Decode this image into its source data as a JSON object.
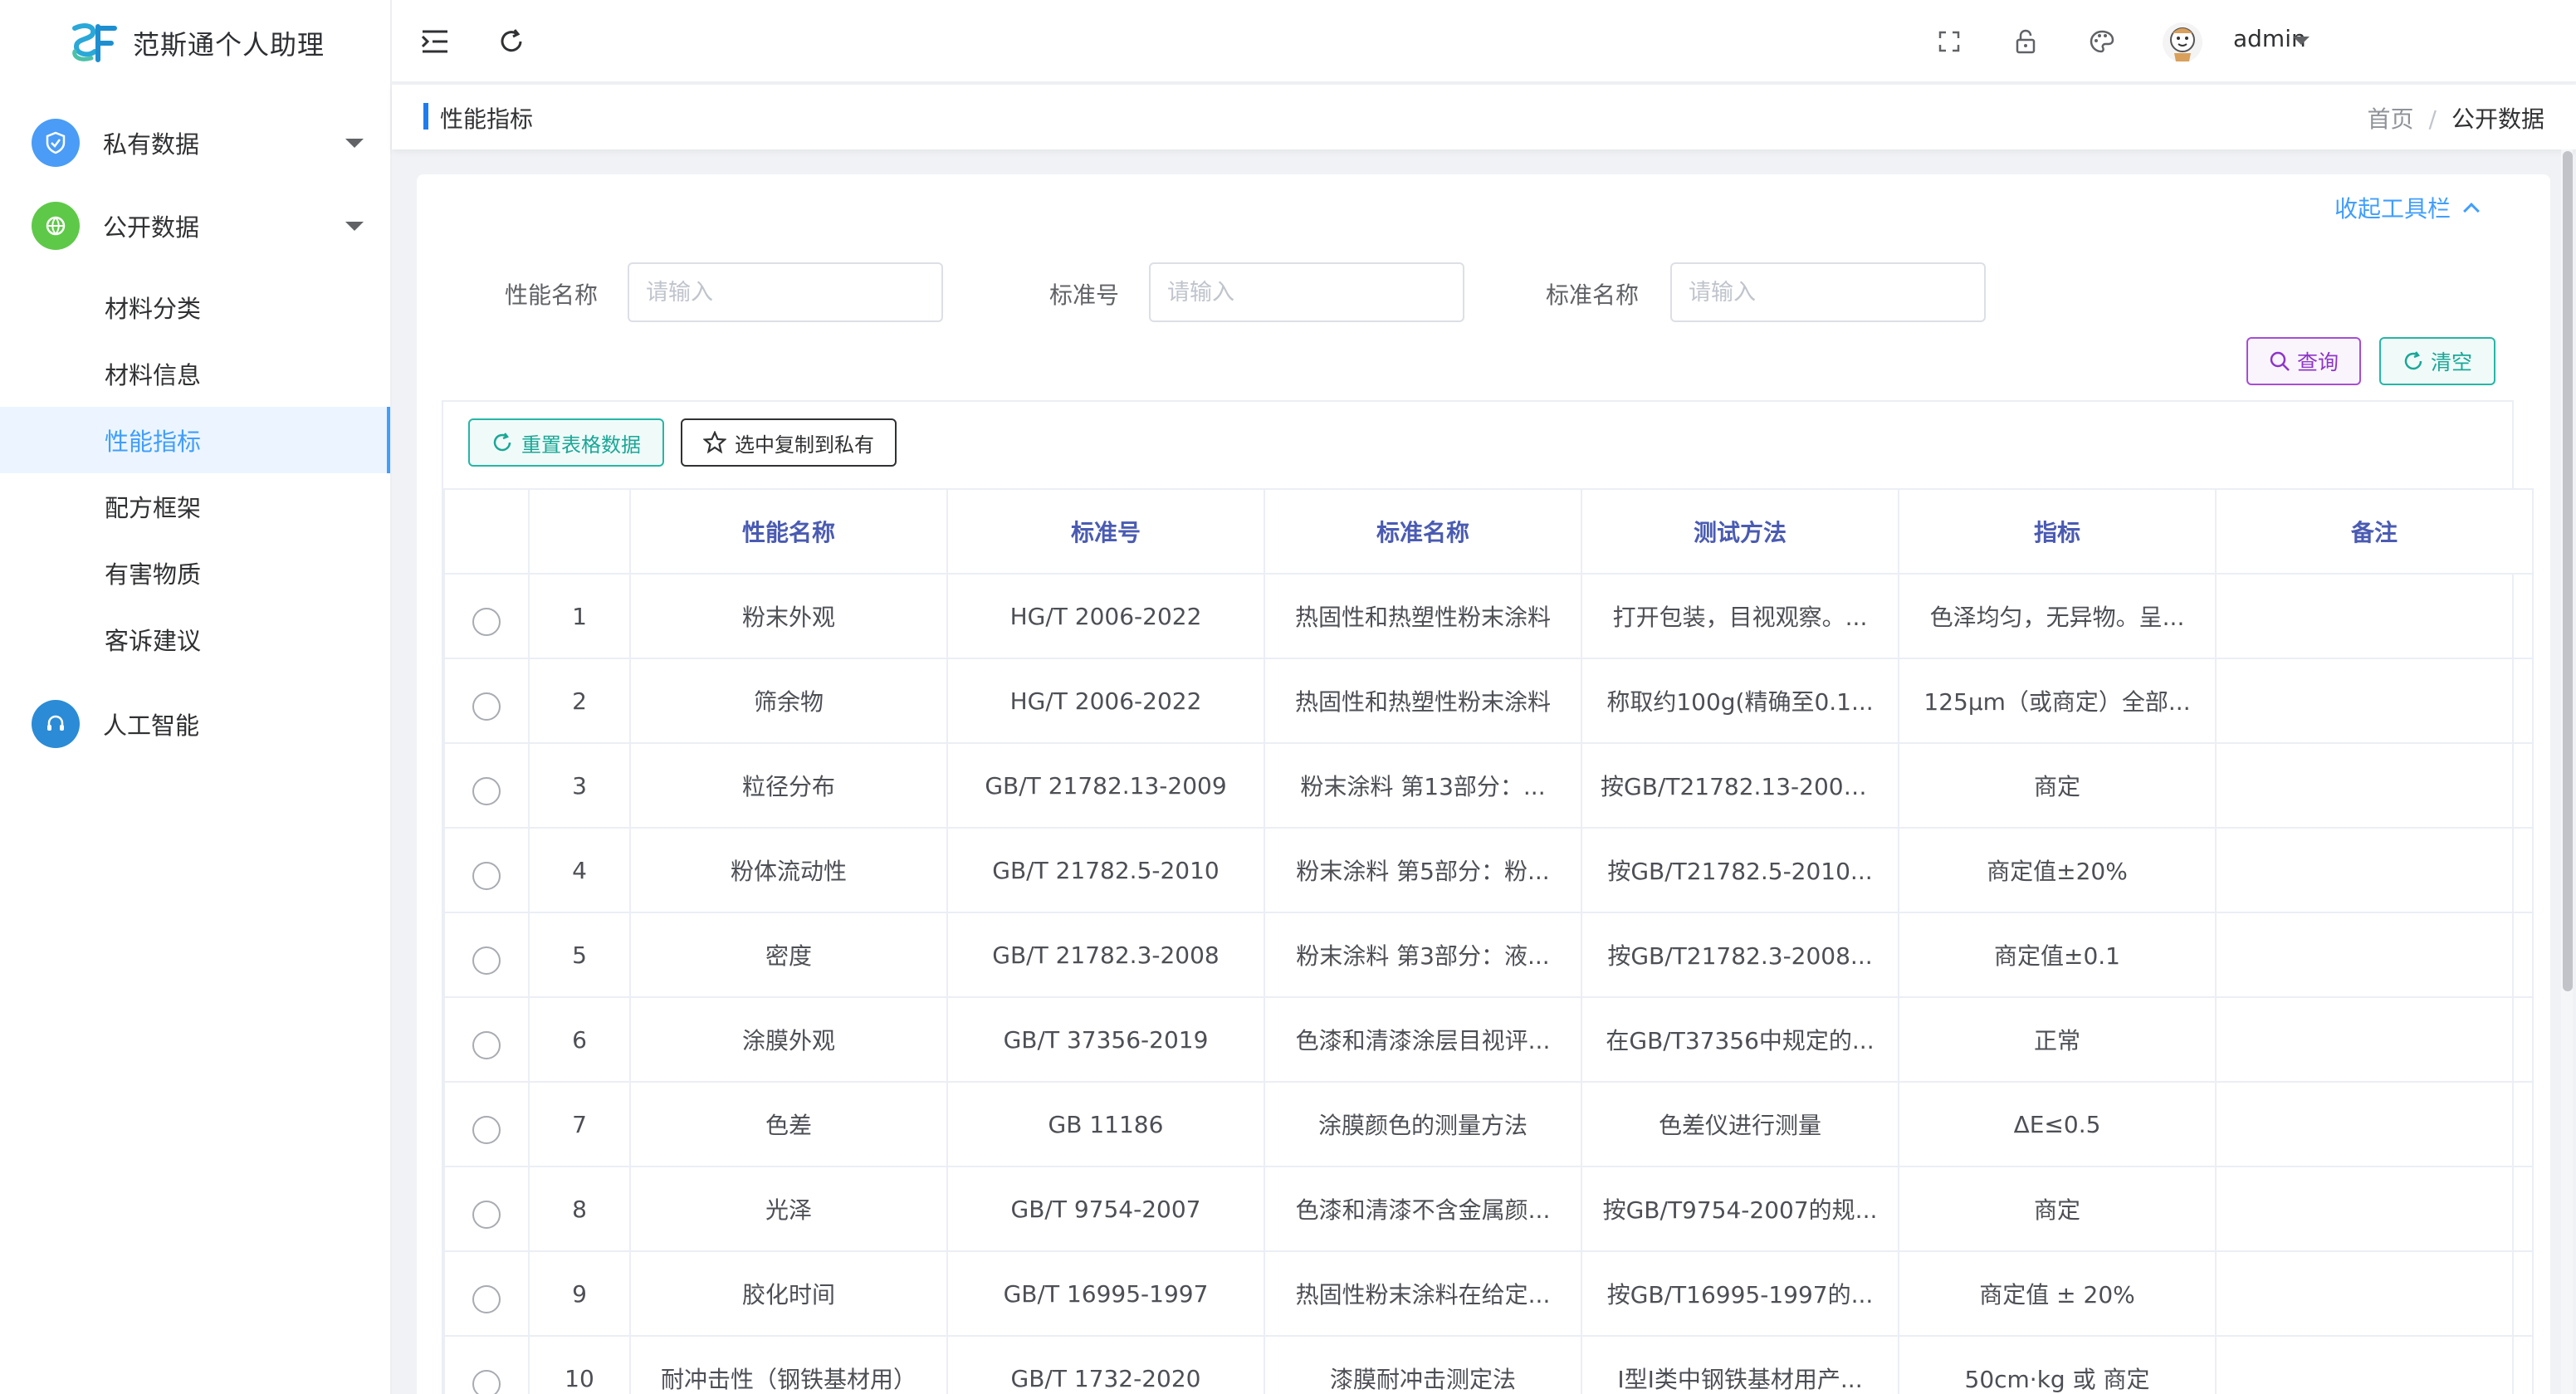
{
  "app": {
    "title": "范斯通个人助理"
  },
  "sidebar": {
    "groups": [
      {
        "label": "私有数据",
        "icon": "shield-check-icon",
        "color": "#4a9cf6"
      },
      {
        "label": "公开数据",
        "icon": "globe-icon",
        "color": "#5ec948"
      },
      {
        "label": "人工智能",
        "icon": "headset-icon",
        "color": "#2b8bd6"
      }
    ],
    "sub_items": [
      "材料分类",
      "材料信息",
      "性能指标",
      "配方框架",
      "有害物质",
      "客诉建议"
    ],
    "active_item": "性能指标"
  },
  "header": {
    "user": "admin",
    "icons": [
      "menu-fold-icon",
      "refresh-icon",
      "fullscreen-icon",
      "lock-icon",
      "palette-icon",
      "avatar"
    ]
  },
  "breadcrumb": {
    "page_title": "性能指标",
    "home": "首页",
    "separator": "/",
    "current": "公开数据"
  },
  "toolbar": {
    "collapse_label": "收起工具栏"
  },
  "filters": {
    "property_name_label": "性能名称",
    "property_name_placeholder": "请输入",
    "standard_no_label": "标准号",
    "standard_no_placeholder": "请输入",
    "standard_name_label": "标准名称",
    "standard_name_placeholder": "请输入",
    "query_label": "查询",
    "clear_label": "清空"
  },
  "table": {
    "reset_label": "重置表格数据",
    "copy_label": "选中复制到私有",
    "columns": [
      "",
      "",
      "性能名称",
      "标准号",
      "标准名称",
      "测试方法",
      "指标",
      "备注"
    ],
    "rows": [
      [
        "1",
        "粉末外观",
        "HG/T 2006-2022",
        "热固性和热塑性粉末涂料",
        "打开包装，目视观察。...",
        "色泽均匀，无异物。呈...",
        ""
      ],
      [
        "2",
        "筛余物",
        "HG/T 2006-2022",
        "热固性和热塑性粉末涂料",
        "称取约100g(精确至0.1...",
        "125μm（或商定）全部...",
        ""
      ],
      [
        "3",
        "粒径分布",
        "GB/T 21782.13-2009",
        "粉末涂料 第13部分：...",
        "按GB/T21782.13-2009...",
        "商定",
        ""
      ],
      [
        "4",
        "粉体流动性",
        "GB/T 21782.5-2010",
        "粉末涂料 第5部分：粉...",
        "按GB/T21782.5-2010...",
        "商定值±20%",
        ""
      ],
      [
        "5",
        "密度",
        "GB/T 21782.3-2008",
        "粉末涂料 第3部分：液...",
        "按GB/T21782.3-2008...",
        "商定值±0.1",
        ""
      ],
      [
        "6",
        "涂膜外观",
        "GB/T 37356-2019",
        "色漆和清漆涂层目视评...",
        "在GB/T37356中规定的...",
        "正常",
        ""
      ],
      [
        "7",
        "色差",
        "GB 11186",
        "涂膜颜色的测量方法",
        "色差仪进行测量",
        "ΔE≤0.5",
        ""
      ],
      [
        "8",
        "光泽",
        "GB/T 9754-2007",
        "色漆和清漆不含金属颜...",
        "按GB/T9754-2007的规...",
        "商定",
        ""
      ],
      [
        "9",
        "胶化时间",
        "GB/T 16995-1997",
        "热固性粉末涂料在给定...",
        "按GB/T16995-1997的...",
        "商定值 ± 20%",
        ""
      ],
      [
        "10",
        "耐冲击性（钢铁基材用）",
        "GB/T 1732-2020",
        "漆膜耐冲击测定法",
        "Ⅰ型Ⅰ类中钢铁基材用产...",
        "50cm·kg 或 商定",
        ""
      ]
    ]
  },
  "colors": {
    "primary": "#409eff",
    "query_purple": "#8e35c8",
    "teal": "#1aa797",
    "header_text": "#4a5bb3"
  }
}
